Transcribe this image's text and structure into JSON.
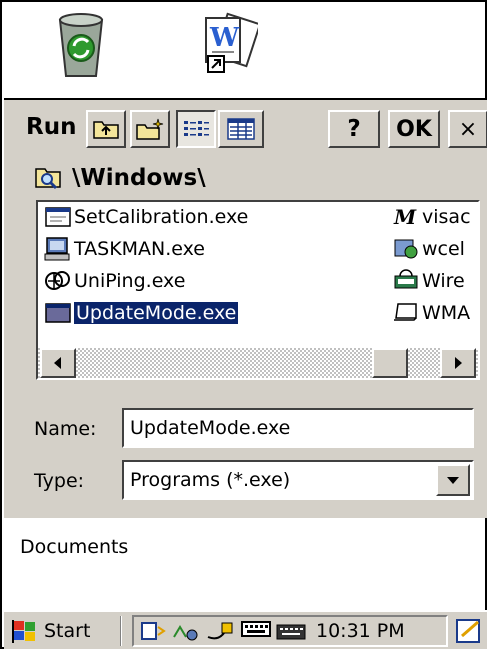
{
  "desktop": {
    "icons": [
      {
        "name": "recycle-bin-icon"
      },
      {
        "name": "wordpad-shortcut-icon"
      }
    ],
    "documents_label": "Documents"
  },
  "dialog": {
    "title": "Run",
    "toolbar": {
      "help_label": "?",
      "ok_label": "OK",
      "close_label": "×"
    },
    "path": "\\Windows\\",
    "files": [
      {
        "label": "SetCalibration.exe",
        "icon": "calibration-app-icon"
      },
      {
        "label": "TASKMAN.exe",
        "icon": "taskman-app-icon"
      },
      {
        "label": "UniPing.exe",
        "icon": "uniping-app-icon"
      },
      {
        "label": "UpdateMode.exe",
        "icon": "updatemode-app-icon",
        "selected": true
      },
      {
        "label": "visac",
        "icon": "visa-app-icon"
      },
      {
        "label": "wcel",
        "icon": "wcel-app-icon"
      },
      {
        "label": "Wire",
        "icon": "wireless-app-icon"
      },
      {
        "label": "WMA",
        "icon": "wma-app-icon"
      }
    ],
    "name_label": "Name:",
    "name_value": "UpdateMode.exe",
    "type_label": "Type:",
    "type_value": "Programs (*.exe)"
  },
  "taskbar": {
    "start_label": "Start",
    "clock": "10:31 PM"
  }
}
